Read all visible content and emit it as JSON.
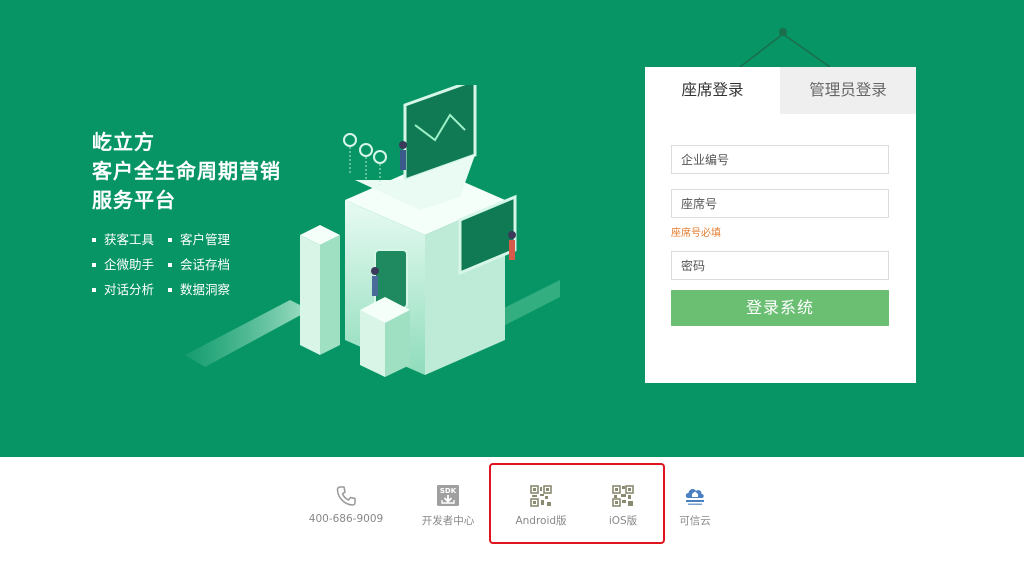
{
  "brand": {
    "lines": [
      "屹立方",
      "客户全生命周期营销",
      "服务平台"
    ]
  },
  "features": [
    "获客工具",
    "客户管理",
    "企微助手",
    "会话存档",
    "对话分析",
    "数据洞察"
  ],
  "login": {
    "tabs": [
      {
        "label": "座席登录",
        "active": true
      },
      {
        "label": "管理员登录",
        "active": false
      }
    ],
    "company_placeholder": "企业编号",
    "seat_placeholder": "座席号",
    "seat_error": "座席号必填",
    "password_placeholder": "密码",
    "submit_label": "登录系统"
  },
  "footer": {
    "phone": "400-686-9009",
    "developer": "开发者中心",
    "sdk_badge": "SDK",
    "android": "Android版",
    "ios": "iOS版",
    "trusted": "可信云"
  },
  "colors": {
    "hero_bg": "#079566",
    "submit_bg": "#6bbf73",
    "error": "#e57c2c",
    "highlight": "#e0141e"
  },
  "icons": [
    "phone-icon",
    "sdk-icon",
    "android-qr-icon",
    "ios-qr-icon",
    "trusted-cloud-icon"
  ]
}
